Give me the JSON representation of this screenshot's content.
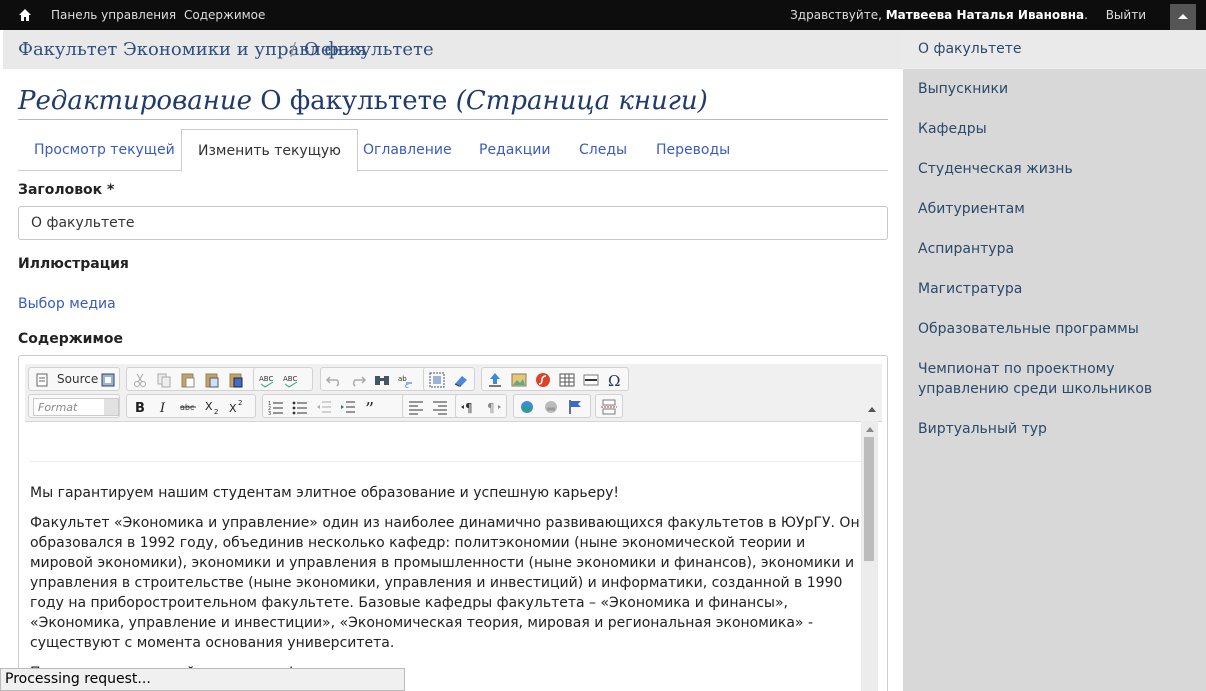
{
  "admin_bar": {
    "dashboard_label": "Панель управления",
    "content_label": "Содержимое",
    "greeting_prefix": "Здравствуйте, ",
    "user_name": "Матвеева Наталья Ивановна",
    "greeting_suffix": ".",
    "logout_label": "Выйти"
  },
  "breadcrumb": {
    "items": [
      "Факультет Экономики и управления",
      "О факультете"
    ],
    "separator": "/"
  },
  "page": {
    "title_prefix": "Редактирование",
    "title_name": "О факультете",
    "title_suffix": "(Страница книги)"
  },
  "tabs": [
    {
      "label": "Просмотр текущей"
    },
    {
      "label": "Изменить текущую"
    },
    {
      "label": "Оглавление"
    },
    {
      "label": "Редакции"
    },
    {
      "label": "Следы"
    },
    {
      "label": "Переводы"
    }
  ],
  "form": {
    "title_label": "Заголовок *",
    "title_value": "О факультете",
    "illustration_label": "Иллюстрация",
    "media_link": "Выбор медиа",
    "content_label": "Содержимое"
  },
  "editor": {
    "source_label": "Source",
    "format_placeholder": "Format",
    "paragraphs": [
      "Мы гарантируем нашим студентам элитное образование и успешную карьеру!",
      "Факультет «Экономика и управление» один из наиболее динамично развивающихся факультетов в ЮУрГУ. Он образовался в 1992 году, объединив несколько кафедр: политэкономии (ныне экономической теории и мировой экономики), экономики и управления в промышленности (ныне экономики и финансов), экономики и управления в строительстве (ныне экономики, управления и инвестиций) и информатики, созданной в 1990 году на приборостроительном факультете. Базовые кафедры факультета  – «Экономика и финансы», «Экономика, управление и инвестиции», «Экономическая теория, мировая и региональная экономика» - существуют с момента основания университета.",
      "Подготовка ... важнейшая задача факультета."
    ]
  },
  "sidebar": {
    "items": [
      "О факультете",
      "Выпускники",
      "Кафедры",
      "Студенческая жизнь",
      "Абитуриентам",
      "Аспирантура",
      "Магистратура",
      "Образовательные программы",
      "Чемпионат по проектному управлению среди школьников",
      "Виртуальный тур"
    ]
  },
  "status": {
    "text": "Processing request..."
  },
  "colors": {
    "admin_bar": "#0d0d0d",
    "link": "#3a5bbf",
    "title": "#1f3a6b",
    "sidebar_bg": "#d8d8d8"
  }
}
